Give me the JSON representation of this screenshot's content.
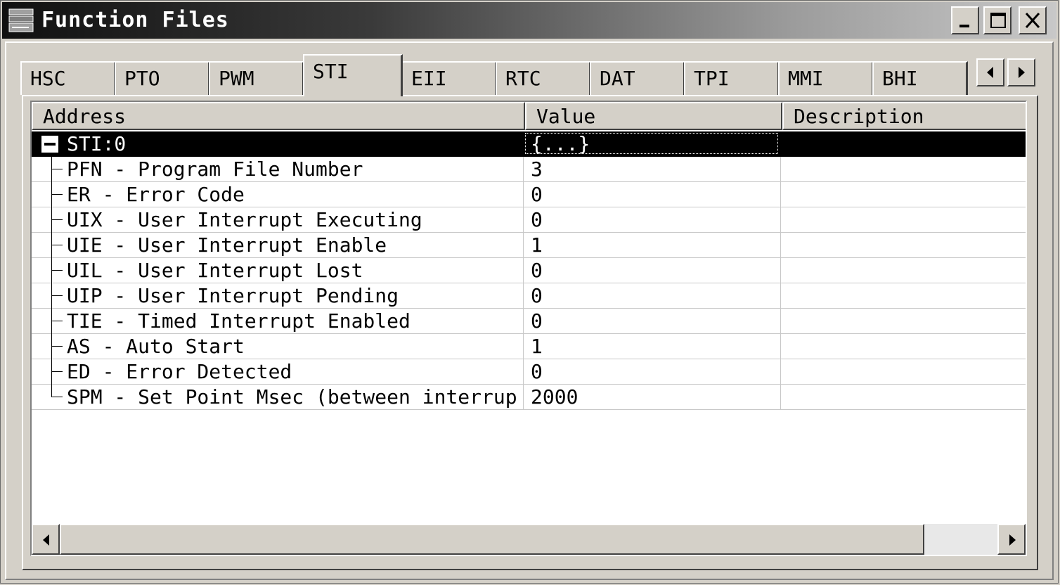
{
  "window": {
    "title": "Function Files",
    "icon": "window-app-icon",
    "controls": [
      "minimize-icon",
      "maximize-icon",
      "close-icon"
    ]
  },
  "tabs": [
    {
      "label": "HSC"
    },
    {
      "label": "PTO"
    },
    {
      "label": "PWM"
    },
    {
      "label": "STI"
    },
    {
      "label": "EII"
    },
    {
      "label": "RTC"
    },
    {
      "label": "DAT"
    },
    {
      "label": "TPI"
    },
    {
      "label": "MMI"
    },
    {
      "label": "BHI"
    }
  ],
  "active_tab": "STI",
  "table": {
    "columns": [
      "Address",
      "Value",
      "Description"
    ],
    "root": {
      "address": "STI:0",
      "value": "{...}",
      "description": ""
    },
    "rows": [
      {
        "address": "PFN - Program File Number",
        "value": "3"
      },
      {
        "address": "ER - Error Code",
        "value": "0"
      },
      {
        "address": "UIX - User Interrupt Executing",
        "value": "0"
      },
      {
        "address": "UIE - User Interrupt Enable",
        "value": "1"
      },
      {
        "address": "UIL - User Interrupt Lost",
        "value": "0"
      },
      {
        "address": "UIP - User Interrupt Pending",
        "value": "0"
      },
      {
        "address": "TIE - Timed Interrupt Enabled",
        "value": "0"
      },
      {
        "address": "AS - Auto Start",
        "value": "1"
      },
      {
        "address": "ED - Error Detected",
        "value": "0"
      },
      {
        "address": "SPM - Set Point Msec (between interrup",
        "value": "2000"
      }
    ]
  },
  "colors": {
    "selection": "#000000",
    "face": "#d4d0c8"
  }
}
